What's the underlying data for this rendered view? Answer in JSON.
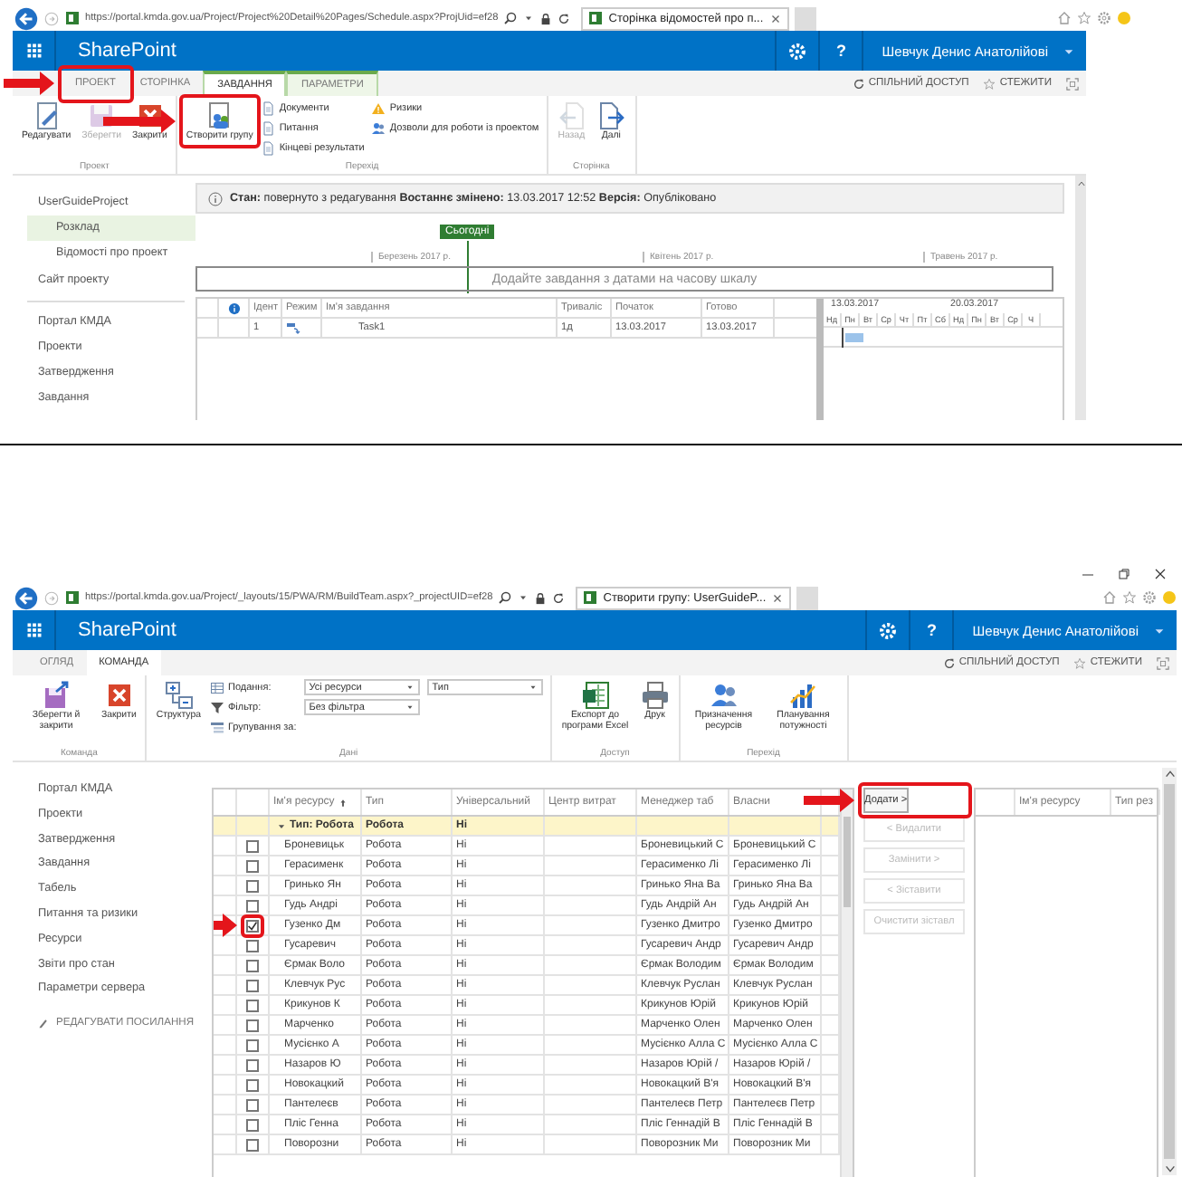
{
  "schedule_screen": {
    "browser": {
      "url": "https://portal.kmda.gov.ua/Project/Project%20Detail%20Pages/Schedule.aspx?ProjUid=ef28",
      "tab_title": "Сторінка відомостей про п..."
    },
    "suite_bar": {
      "brand": "SharePoint",
      "help": "?",
      "user": "Шевчук Денис Анатолійові"
    },
    "ribbon": {
      "tabs": [
        {
          "label": "ПРОЕКТ",
          "selected": false,
          "contextual": false,
          "highlighted": true
        },
        {
          "label": "СТОРІНКА",
          "selected": false,
          "contextual": false,
          "highlighted": false
        },
        {
          "label": "ЗАВДАННЯ",
          "selected": true,
          "contextual": true,
          "highlighted": false
        },
        {
          "label": "ПАРАМЕТРИ",
          "selected": false,
          "contextual": true,
          "highlighted": false
        }
      ],
      "actions": [
        "СПІЛЬНИЙ ДОСТУП",
        "СТЕЖИТИ"
      ],
      "groups": [
        {
          "label": "Проект",
          "commands": [
            {
              "label": "Редагувати",
              "kind": "large",
              "disabled": false,
              "highlighted": false
            },
            {
              "label": "Зберегти",
              "kind": "large",
              "disabled": true,
              "highlighted": false
            },
            {
              "label": "Закрити",
              "kind": "large",
              "disabled": false,
              "highlighted": false
            }
          ]
        },
        {
          "label": "Перехід",
          "commands": [
            {
              "label": "Створити групу",
              "kind": "large",
              "disabled": false,
              "highlighted": true
            },
            {
              "label": "Документи",
              "kind": "small",
              "disabled": false,
              "highlighted": false
            },
            {
              "label": "Питання",
              "kind": "small",
              "disabled": false,
              "highlighted": false
            },
            {
              "label": "Кінцеві результати",
              "kind": "small",
              "disabled": false,
              "highlighted": false
            },
            {
              "label": "Ризики",
              "kind": "small",
              "disabled": false,
              "highlighted": false
            },
            {
              "label": "Дозволи для роботи із проектом",
              "kind": "small",
              "disabled": false,
              "highlighted": false
            }
          ]
        },
        {
          "label": "Сторінка",
          "commands": [
            {
              "label": "Назад",
              "kind": "large",
              "disabled": true,
              "highlighted": false
            },
            {
              "label": "Далі",
              "kind": "large",
              "disabled": false,
              "highlighted": false
            }
          ]
        }
      ]
    },
    "project_nav": [
      {
        "label": "UserGuideProject",
        "selected": false,
        "children": [
          {
            "label": "Розклад",
            "selected": true
          },
          {
            "label": "Відомості про проект",
            "selected": false
          }
        ]
      },
      {
        "label": "Сайт проекту",
        "selected": false
      }
    ],
    "site_nav": [
      "Портал КМДА",
      "Проекти",
      "Затвердження",
      "Завдання"
    ],
    "status": "**Стан:** повернуто з редагування **Востаннє змінено:** 13.03.2017 12:52 **Версія:** Опубліковано",
    "timeline": {
      "today": "Сьогодні",
      "months": [
        "Березень 2017 р.",
        "Квітень 2017 р.",
        "Травень 2017 р."
      ],
      "hint": "Додайте завдання з датами на часову шкалу"
    },
    "tasks": {
      "columns": [
        "Ідент",
        "Режим",
        "Ім'я завдання",
        "Тривaліс",
        "Початок",
        "Готово"
      ],
      "rows": [
        {
          "id": "1",
          "name": "Task1",
          "duration": "1д",
          "start": "13.03.2017",
          "finish": "13.03.2017"
        }
      ]
    },
    "gantt": {
      "weeks": [
        "13.03.2017",
        "20.03.2017"
      ],
      "days": [
        "Нд",
        "Пн",
        "Вт",
        "Ср",
        "Чт",
        "Пт",
        "Сб",
        "Нд",
        "Пн",
        "Вт",
        "Ср",
        "Ч"
      ]
    }
  },
  "team_screen": {
    "browser": {
      "url": "https://portal.kmda.gov.ua/Project/_layouts/15/PWA/RM/BuildTeam.aspx?_projectUID=ef28",
      "tab_title": "Створити групу: UserGuideP..."
    },
    "suite_bar": {
      "brand": "SharePoint",
      "help": "?",
      "user": "Шевчук Денис Анатолійові"
    },
    "ribbon": {
      "tabs": [
        {
          "label": "ОГЛЯД",
          "selected": false,
          "contextual": false,
          "highlighted": false
        },
        {
          "label": "КОМАНДА",
          "selected": true,
          "contextual": false,
          "highlighted": false
        }
      ],
      "actions": [
        "СПІЛЬНИЙ ДОСТУП",
        "СТЕЖИТИ"
      ],
      "groups": [
        {
          "label": "Команда",
          "commands": [
            {
              "label": "Зберегти й закрити",
              "kind": "large",
              "disabled": false,
              "highlighted": false
            },
            {
              "label": "Закрити",
              "kind": "large",
              "disabled": false,
              "highlighted": false
            }
          ]
        },
        {
          "label": "Дані",
          "commands": [
            {
              "label": "Структура",
              "kind": "large",
              "disabled": false,
              "highlighted": false
            },
            {
              "label": "Подання:",
              "kind": "small",
              "disabled": false,
              "highlighted": false
            },
            {
              "label": "Фільтр:",
              "kind": "small",
              "disabled": false,
              "highlighted": false
            },
            {
              "label": "Групування за:",
              "kind": "small",
              "disabled": false,
              "highlighted": false
            },
            {
              "label": "Усі ресурси",
              "kind": "select",
              "disabled": false,
              "highlighted": false
            },
            {
              "label": "Без фільтра",
              "kind": "select",
              "disabled": false,
              "highlighted": false
            },
            {
              "label": "Тип",
              "kind": "select",
              "disabled": false,
              "highlighted": false
            }
          ]
        },
        {
          "label": "Доступ",
          "commands": [
            {
              "label": "Експорт до програми Excel",
              "kind": "large",
              "disabled": false,
              "highlighted": false
            },
            {
              "label": "Друк",
              "kind": "large",
              "disabled": false,
              "highlighted": false
            }
          ]
        },
        {
          "label": "Перехід",
          "commands": [
            {
              "label": "Призначення ресурсів",
              "kind": "large",
              "disabled": false,
              "highlighted": false
            },
            {
              "label": "Планування потужності",
              "kind": "large",
              "disabled": false,
              "highlighted": false
            }
          ]
        }
      ]
    },
    "site_nav": [
      "Портал КМДА",
      "Проекти",
      "Затвердження",
      "Завдання",
      "Табель",
      "Питання та ризики",
      "Ресурси",
      "Звіти про стан",
      "Параметри сервера"
    ],
    "edit_links": "РЕДАГУВАТИ ПОСИЛАННЯ",
    "resources": {
      "columns": [
        "Ім'я ресурсу",
        "Тип",
        "Універсальний",
        "Центр витрат",
        "Менеджер таб",
        "Власни"
      ],
      "group": {
        "label": "Тип: Робота",
        "type": "Робота",
        "universal": "Ні"
      },
      "rows": [
        {
          "name": "Броневицьк",
          "type": "Робота",
          "universal": "Ні",
          "manager": "Броневицький С",
          "owner": "Броневицький С",
          "checked": false,
          "highlighted": false
        },
        {
          "name": "Герасименк",
          "type": "Робота",
          "universal": "Ні",
          "manager": "Герасименко Лі",
          "owner": "Герасименко Лі",
          "checked": false,
          "highlighted": false
        },
        {
          "name": "Гринько Ян",
          "type": "Робота",
          "universal": "Ні",
          "manager": "Гринько Яна Ва",
          "owner": "Гринько Яна Ва",
          "checked": false,
          "highlighted": false
        },
        {
          "name": "Гудь Андрі",
          "type": "Робота",
          "universal": "Ні",
          "manager": "Гудь Андрій Ан",
          "owner": "Гудь Андрій Ан",
          "checked": false,
          "highlighted": false
        },
        {
          "name": "Гузенко Дм",
          "type": "Робота",
          "universal": "Ні",
          "manager": "Гузенко Дмитро",
          "owner": "Гузенко Дмитро",
          "checked": true,
          "highlighted": true
        },
        {
          "name": "Гусаревич",
          "type": "Робота",
          "universal": "Ні",
          "manager": "Гусаревич Андр",
          "owner": "Гусаревич Андр",
          "checked": false,
          "highlighted": false
        },
        {
          "name": "Єрмак Воло",
          "type": "Робота",
          "universal": "Ні",
          "manager": "Єрмак Володим",
          "owner": "Єрмак Володим",
          "checked": false,
          "highlighted": false
        },
        {
          "name": "Клевчук Рус",
          "type": "Робота",
          "universal": "Ні",
          "manager": "Клевчук Руслан",
          "owner": "Клевчук Руслан",
          "checked": false,
          "highlighted": false
        },
        {
          "name": "Крикунов К",
          "type": "Робота",
          "universal": "Ні",
          "manager": "Крикунов Юрій",
          "owner": "Крикунов Юрій",
          "checked": false,
          "highlighted": false
        },
        {
          "name": "Марченко",
          "type": "Робота",
          "universal": "Ні",
          "manager": "Марченко Олен",
          "owner": "Марченко Олен",
          "checked": false,
          "highlighted": false
        },
        {
          "name": "Мусієнко А",
          "type": "Робота",
          "universal": "Ні",
          "manager": "Мусієнко Алла С",
          "owner": "Мусієнко Алла С",
          "checked": false,
          "highlighted": false
        },
        {
          "name": "Назаров Ю",
          "type": "Робота",
          "universal": "Ні",
          "manager": "Назаров Юрій /",
          "owner": "Назаров Юрій /",
          "checked": false,
          "highlighted": false
        },
        {
          "name": "Новокацкий",
          "type": "Робота",
          "universal": "Ні",
          "manager": "Новокацкий В'я",
          "owner": "Новокацкий В'я",
          "checked": false,
          "highlighted": false
        },
        {
          "name": "Пантелеєв",
          "type": "Робота",
          "universal": "Ні",
          "manager": "Пантелеєв Петр",
          "owner": "Пантелеєв Петр",
          "checked": false,
          "highlighted": false
        },
        {
          "name": "Пліс Генна",
          "type": "Робота",
          "universal": "Ні",
          "manager": "Пліс Геннадій В",
          "owner": "Пліс Геннадій В",
          "checked": false,
          "highlighted": false
        },
        {
          "name": "Поворозни",
          "type": "Робота",
          "universal": "Ні",
          "manager": "Поворозник Ми",
          "owner": "Поворозник Ми",
          "checked": false,
          "highlighted": false
        }
      ]
    },
    "team_actions": [
      {
        "label": "Додати >",
        "disabled": false,
        "highlighted": true
      },
      {
        "label": "< Видалити",
        "disabled": true,
        "highlighted": false
      },
      {
        "label": "Замінити >",
        "disabled": true,
        "highlighted": false
      },
      {
        "label": "< Зіставити",
        "disabled": true,
        "highlighted": false
      },
      {
        "label": "Очистити зіставл",
        "disabled": true,
        "highlighted": false
      }
    ],
    "team_grid": {
      "columns": [
        "Ім'я ресурсу",
        "Тип рез"
      ]
    }
  }
}
